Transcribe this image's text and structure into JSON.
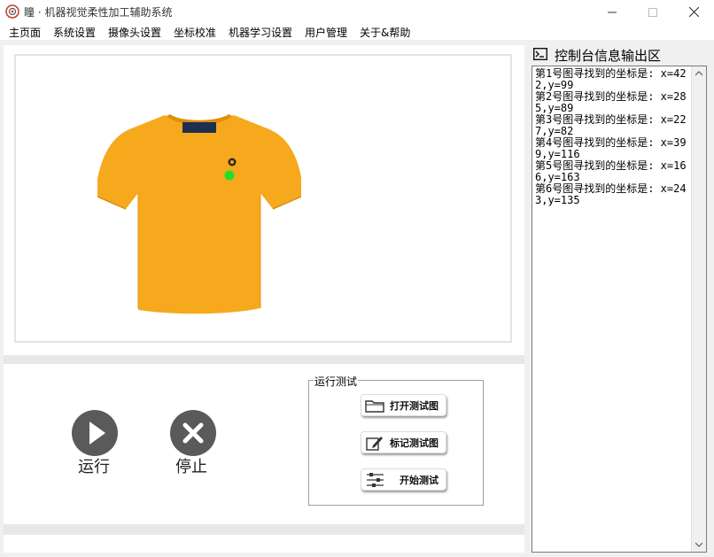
{
  "window": {
    "title": "瞳 · 机器视觉柔性加工辅助系统",
    "controls": {
      "minimize": "minimize-icon",
      "maximize": "maximize-icon",
      "close": "close-icon"
    }
  },
  "menu": [
    {
      "label": "主页面"
    },
    {
      "label": "系统设置"
    },
    {
      "label": "摄像头设置"
    },
    {
      "label": "坐标校准"
    },
    {
      "label": "机器学习设置"
    },
    {
      "label": "用户管理"
    },
    {
      "label": "关于&帮助"
    }
  ],
  "controls": {
    "run_label": "运行",
    "stop_label": "停止"
  },
  "test_group": {
    "title": "运行测试",
    "buttons": [
      {
        "label": "打开测试图",
        "icon": "folder-icon"
      },
      {
        "label": "标记测试图",
        "icon": "edit-icon"
      },
      {
        "label": "开始测试",
        "icon": "sliders-icon"
      }
    ]
  },
  "console": {
    "title": "控制台信息输出区",
    "lines": [
      "第1号图寻找到的坐标是: x=422,y=99",
      "第2号图寻找到的坐标是: x=285,y=89",
      "第3号图寻找到的坐标是: x=227,y=82",
      "第4号图寻找到的坐标是: x=399,y=116",
      "第5号图寻找到的坐标是: x=166,y=163",
      "第6号图寻找到的坐标是: x=243,y=135"
    ]
  },
  "colors": {
    "shirt": "#f6a91c",
    "marker": "#22e02a",
    "round_button": "#5a5a5a"
  }
}
